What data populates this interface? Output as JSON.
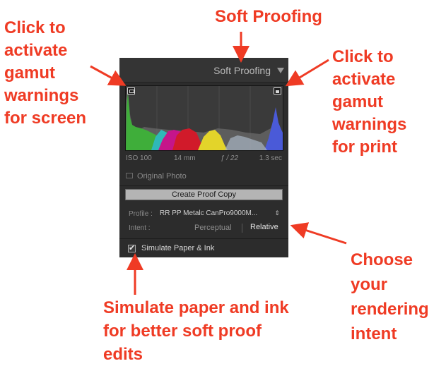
{
  "annotations": {
    "screen_warning": [
      "Click to",
      "activate",
      "gamut",
      "warnings",
      "for screen"
    ],
    "panel_title": "Soft Proofing",
    "print_warning": [
      "Click to",
      "activate",
      "gamut",
      "warnings",
      "for print"
    ],
    "rendering_intent": [
      "Choose",
      "your",
      "rendering",
      "intent"
    ],
    "simulate": [
      "Simulate paper and ink",
      "for better soft proof",
      "edits"
    ],
    "color": "#ef3b24"
  },
  "panel": {
    "title": "Soft Proofing",
    "collapse_icon": "triangle-down-icon",
    "screen_warning_icon": "monitor-icon",
    "print_warning_icon": "paper-icon",
    "exif": {
      "iso": "ISO 100",
      "focal": "14 mm",
      "aperture": "ƒ / 22",
      "shutter": "1.3 sec"
    },
    "original_photo_label": "Original Photo",
    "create_proof_copy_label": "Create Proof Copy",
    "profile_label": "Profile :",
    "profile_value": "RR PP Metalc CanPro9000M...",
    "intent_label": "Intent :",
    "intent_options": [
      "Perceptual",
      "Relative"
    ],
    "intent_selected": "Relative",
    "simulate_label": "Simulate Paper & Ink",
    "simulate_checked": true,
    "checkmark": "✔",
    "updown_arrows": "⇕"
  }
}
